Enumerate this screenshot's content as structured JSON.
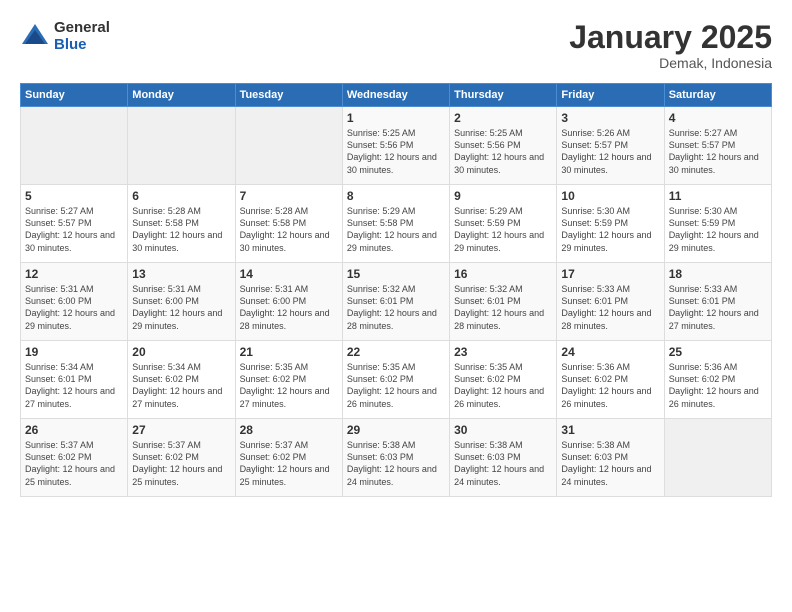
{
  "logo": {
    "general": "General",
    "blue": "Blue"
  },
  "header": {
    "month": "January 2025",
    "location": "Demak, Indonesia"
  },
  "weekdays": [
    "Sunday",
    "Monday",
    "Tuesday",
    "Wednesday",
    "Thursday",
    "Friday",
    "Saturday"
  ],
  "weeks": [
    [
      {
        "day": "",
        "sunrise": "",
        "sunset": "",
        "daylight": ""
      },
      {
        "day": "",
        "sunrise": "",
        "sunset": "",
        "daylight": ""
      },
      {
        "day": "",
        "sunrise": "",
        "sunset": "",
        "daylight": ""
      },
      {
        "day": "1",
        "sunrise": "Sunrise: 5:25 AM",
        "sunset": "Sunset: 5:56 PM",
        "daylight": "Daylight: 12 hours and 30 minutes."
      },
      {
        "day": "2",
        "sunrise": "Sunrise: 5:25 AM",
        "sunset": "Sunset: 5:56 PM",
        "daylight": "Daylight: 12 hours and 30 minutes."
      },
      {
        "day": "3",
        "sunrise": "Sunrise: 5:26 AM",
        "sunset": "Sunset: 5:57 PM",
        "daylight": "Daylight: 12 hours and 30 minutes."
      },
      {
        "day": "4",
        "sunrise": "Sunrise: 5:27 AM",
        "sunset": "Sunset: 5:57 PM",
        "daylight": "Daylight: 12 hours and 30 minutes."
      }
    ],
    [
      {
        "day": "5",
        "sunrise": "Sunrise: 5:27 AM",
        "sunset": "Sunset: 5:57 PM",
        "daylight": "Daylight: 12 hours and 30 minutes."
      },
      {
        "day": "6",
        "sunrise": "Sunrise: 5:28 AM",
        "sunset": "Sunset: 5:58 PM",
        "daylight": "Daylight: 12 hours and 30 minutes."
      },
      {
        "day": "7",
        "sunrise": "Sunrise: 5:28 AM",
        "sunset": "Sunset: 5:58 PM",
        "daylight": "Daylight: 12 hours and 30 minutes."
      },
      {
        "day": "8",
        "sunrise": "Sunrise: 5:29 AM",
        "sunset": "Sunset: 5:58 PM",
        "daylight": "Daylight: 12 hours and 29 minutes."
      },
      {
        "day": "9",
        "sunrise": "Sunrise: 5:29 AM",
        "sunset": "Sunset: 5:59 PM",
        "daylight": "Daylight: 12 hours and 29 minutes."
      },
      {
        "day": "10",
        "sunrise": "Sunrise: 5:30 AM",
        "sunset": "Sunset: 5:59 PM",
        "daylight": "Daylight: 12 hours and 29 minutes."
      },
      {
        "day": "11",
        "sunrise": "Sunrise: 5:30 AM",
        "sunset": "Sunset: 5:59 PM",
        "daylight": "Daylight: 12 hours and 29 minutes."
      }
    ],
    [
      {
        "day": "12",
        "sunrise": "Sunrise: 5:31 AM",
        "sunset": "Sunset: 6:00 PM",
        "daylight": "Daylight: 12 hours and 29 minutes."
      },
      {
        "day": "13",
        "sunrise": "Sunrise: 5:31 AM",
        "sunset": "Sunset: 6:00 PM",
        "daylight": "Daylight: 12 hours and 29 minutes."
      },
      {
        "day": "14",
        "sunrise": "Sunrise: 5:31 AM",
        "sunset": "Sunset: 6:00 PM",
        "daylight": "Daylight: 12 hours and 28 minutes."
      },
      {
        "day": "15",
        "sunrise": "Sunrise: 5:32 AM",
        "sunset": "Sunset: 6:01 PM",
        "daylight": "Daylight: 12 hours and 28 minutes."
      },
      {
        "day": "16",
        "sunrise": "Sunrise: 5:32 AM",
        "sunset": "Sunset: 6:01 PM",
        "daylight": "Daylight: 12 hours and 28 minutes."
      },
      {
        "day": "17",
        "sunrise": "Sunrise: 5:33 AM",
        "sunset": "Sunset: 6:01 PM",
        "daylight": "Daylight: 12 hours and 28 minutes."
      },
      {
        "day": "18",
        "sunrise": "Sunrise: 5:33 AM",
        "sunset": "Sunset: 6:01 PM",
        "daylight": "Daylight: 12 hours and 27 minutes."
      }
    ],
    [
      {
        "day": "19",
        "sunrise": "Sunrise: 5:34 AM",
        "sunset": "Sunset: 6:01 PM",
        "daylight": "Daylight: 12 hours and 27 minutes."
      },
      {
        "day": "20",
        "sunrise": "Sunrise: 5:34 AM",
        "sunset": "Sunset: 6:02 PM",
        "daylight": "Daylight: 12 hours and 27 minutes."
      },
      {
        "day": "21",
        "sunrise": "Sunrise: 5:35 AM",
        "sunset": "Sunset: 6:02 PM",
        "daylight": "Daylight: 12 hours and 27 minutes."
      },
      {
        "day": "22",
        "sunrise": "Sunrise: 5:35 AM",
        "sunset": "Sunset: 6:02 PM",
        "daylight": "Daylight: 12 hours and 26 minutes."
      },
      {
        "day": "23",
        "sunrise": "Sunrise: 5:35 AM",
        "sunset": "Sunset: 6:02 PM",
        "daylight": "Daylight: 12 hours and 26 minutes."
      },
      {
        "day": "24",
        "sunrise": "Sunrise: 5:36 AM",
        "sunset": "Sunset: 6:02 PM",
        "daylight": "Daylight: 12 hours and 26 minutes."
      },
      {
        "day": "25",
        "sunrise": "Sunrise: 5:36 AM",
        "sunset": "Sunset: 6:02 PM",
        "daylight": "Daylight: 12 hours and 26 minutes."
      }
    ],
    [
      {
        "day": "26",
        "sunrise": "Sunrise: 5:37 AM",
        "sunset": "Sunset: 6:02 PM",
        "daylight": "Daylight: 12 hours and 25 minutes."
      },
      {
        "day": "27",
        "sunrise": "Sunrise: 5:37 AM",
        "sunset": "Sunset: 6:02 PM",
        "daylight": "Daylight: 12 hours and 25 minutes."
      },
      {
        "day": "28",
        "sunrise": "Sunrise: 5:37 AM",
        "sunset": "Sunset: 6:02 PM",
        "daylight": "Daylight: 12 hours and 25 minutes."
      },
      {
        "day": "29",
        "sunrise": "Sunrise: 5:38 AM",
        "sunset": "Sunset: 6:03 PM",
        "daylight": "Daylight: 12 hours and 24 minutes."
      },
      {
        "day": "30",
        "sunrise": "Sunrise: 5:38 AM",
        "sunset": "Sunset: 6:03 PM",
        "daylight": "Daylight: 12 hours and 24 minutes."
      },
      {
        "day": "31",
        "sunrise": "Sunrise: 5:38 AM",
        "sunset": "Sunset: 6:03 PM",
        "daylight": "Daylight: 12 hours and 24 minutes."
      },
      {
        "day": "",
        "sunrise": "",
        "sunset": "",
        "daylight": ""
      }
    ]
  ]
}
